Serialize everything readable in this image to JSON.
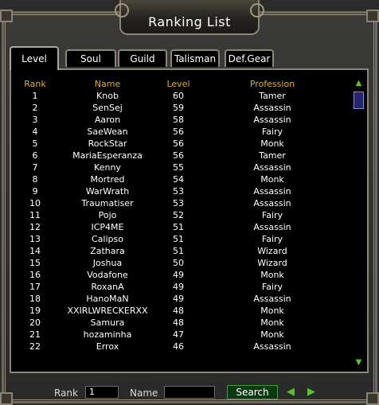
{
  "window": {
    "title": "Ranking List"
  },
  "tabs": [
    {
      "label": "Level",
      "active": true
    },
    {
      "label": "Soul",
      "active": false
    },
    {
      "label": "Guild",
      "active": false
    },
    {
      "label": "Talisman",
      "active": false
    },
    {
      "label": "Def.Gear",
      "active": false
    }
  ],
  "table": {
    "headers": {
      "rank": "Rank",
      "name": "Name",
      "level": "Level",
      "profession": "Profession"
    },
    "rows": [
      {
        "rank": "1",
        "name": "Knob",
        "level": "60",
        "profession": "Tamer"
      },
      {
        "rank": "2",
        "name": "SenSej",
        "level": "59",
        "profession": "Assassin"
      },
      {
        "rank": "3",
        "name": "Aaron",
        "level": "58",
        "profession": "Assassin"
      },
      {
        "rank": "4",
        "name": "SaeWean",
        "level": "56",
        "profession": "Fairy"
      },
      {
        "rank": "5",
        "name": "RockStar",
        "level": "56",
        "profession": "Monk"
      },
      {
        "rank": "6",
        "name": "MariaEsperanza",
        "level": "56",
        "profession": "Tamer"
      },
      {
        "rank": "7",
        "name": "Kenny",
        "level": "55",
        "profession": "Assassin"
      },
      {
        "rank": "8",
        "name": "Mortred",
        "level": "54",
        "profession": "Monk"
      },
      {
        "rank": "9",
        "name": "WarWrath",
        "level": "53",
        "profession": "Assassin"
      },
      {
        "rank": "10",
        "name": "Traumatiser",
        "level": "53",
        "profession": "Assassin"
      },
      {
        "rank": "11",
        "name": "Pojo",
        "level": "52",
        "profession": "Fairy"
      },
      {
        "rank": "12",
        "name": "ICP4ME",
        "level": "51",
        "profession": "Assassin"
      },
      {
        "rank": "13",
        "name": "Calipso",
        "level": "51",
        "profession": "Fairy"
      },
      {
        "rank": "14",
        "name": "Zathara",
        "level": "51",
        "profession": "Wizard"
      },
      {
        "rank": "15",
        "name": "Joshua",
        "level": "50",
        "profession": "Wizard"
      },
      {
        "rank": "16",
        "name": "Vodafone",
        "level": "49",
        "profession": "Monk"
      },
      {
        "rank": "17",
        "name": "RoxanA",
        "level": "49",
        "profession": "Fairy"
      },
      {
        "rank": "18",
        "name": "HanoMaN",
        "level": "49",
        "profession": "Assassin"
      },
      {
        "rank": "19",
        "name": "XXIRLWRECKERXX",
        "level": "48",
        "profession": "Monk"
      },
      {
        "rank": "20",
        "name": "Samura",
        "level": "48",
        "profession": "Monk"
      },
      {
        "rank": "21",
        "name": "hozaminha",
        "level": "47",
        "profession": "Monk"
      },
      {
        "rank": "22",
        "name": "Errox",
        "level": "46",
        "profession": "Assassin"
      }
    ]
  },
  "search": {
    "rank_label": "Rank",
    "rank_value": "1",
    "name_label": "Name",
    "name_value": "",
    "search_label": "Search"
  },
  "icons": {
    "scroll_up": "scroll-up-arrow",
    "scroll_down": "scroll-down-arrow",
    "prev": "prev-page-arrow",
    "next": "next-page-arrow"
  },
  "colors": {
    "header_text": "#e0b020",
    "row_text": "#ffffff",
    "scroll_arrow": "#5fc030",
    "search_button": "#0c3a10"
  }
}
